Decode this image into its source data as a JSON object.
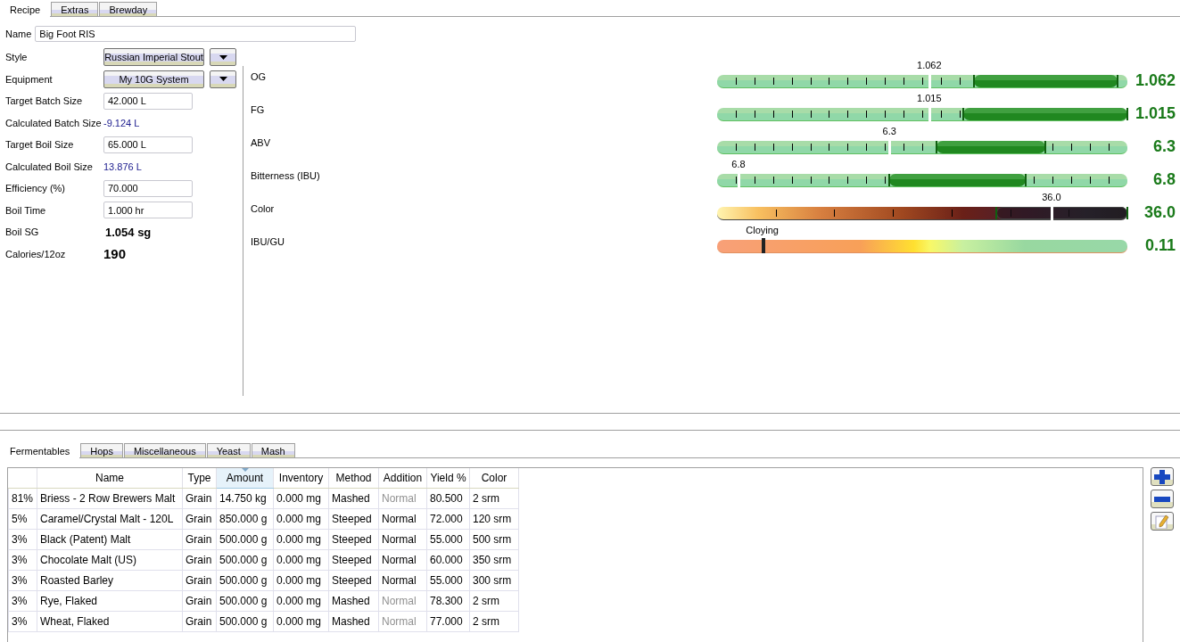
{
  "top_tabs": [
    {
      "label": "Recipe",
      "selected": true
    },
    {
      "label": "Extras",
      "selected": false
    },
    {
      "label": "Brewday",
      "selected": false
    }
  ],
  "name": {
    "label": "Name",
    "value": "Big Foot RIS"
  },
  "fields": [
    {
      "kind": "select",
      "label": "Style",
      "value": "Russian Imperial Stout"
    },
    {
      "kind": "select",
      "label": "Equipment",
      "value": "My 10G System"
    },
    {
      "kind": "input",
      "label": "Target Batch Size",
      "value": "42.000 L"
    },
    {
      "kind": "calc",
      "label": "Calculated Batch Size",
      "value": "-9.124 L"
    },
    {
      "kind": "input",
      "label": "Target Boil Size",
      "value": "65.000 L"
    },
    {
      "kind": "calc",
      "label": "Calculated Boil Size",
      "value": "13.876 L"
    },
    {
      "kind": "input",
      "label": "Efficiency (%)",
      "value": "70.000"
    },
    {
      "kind": "input",
      "label": "Boil Time",
      "value": "1.000 hr"
    },
    {
      "kind": "bold",
      "label": "Boil SG",
      "value": "1.054 sg"
    },
    {
      "kind": "big",
      "label": "Calories/12oz",
      "value": "190"
    }
  ],
  "gauges": [
    {
      "kind": "range",
      "label": "OG",
      "marker_label": "1.062",
      "level": 0.517,
      "range_start": {
        "level": 0.626
      },
      "range_end": {
        "level": 0.976
      },
      "value": "1.062"
    },
    {
      "kind": "range",
      "label": "FG",
      "marker_label": "1.015",
      "level": 0.517,
      "range_start": {
        "level": 0.6
      },
      "range_end": {
        "level": 1.0
      },
      "value": "1.015"
    },
    {
      "kind": "range",
      "label": "ABV",
      "marker_label": "6.3",
      "level": 0.42,
      "range_start": {
        "level": 0.535
      },
      "range_end": {
        "level": 0.8
      },
      "value": "6.3"
    },
    {
      "kind": "range",
      "label": "Bitterness (IBU)",
      "marker_label": "6.8",
      "level": 0.052,
      "range_start": {
        "level": 0.42
      },
      "range_end": {
        "level": 0.752
      },
      "value": "6.8"
    },
    {
      "kind": "color",
      "label": "Color",
      "marker_label": "36.0",
      "level": 0.815,
      "range_start": {
        "level": 0.68
      },
      "range_end": {
        "level": 1.0
      },
      "value": "36.0"
    },
    {
      "kind": "balance",
      "label": "IBU/GU",
      "marker_label": "Cloying",
      "level": 0.11,
      "value": "0.11"
    }
  ],
  "bottom_tabs": [
    {
      "label": "Fermentables",
      "selected": true
    },
    {
      "label": "Hops",
      "selected": false
    },
    {
      "label": "Miscellaneous",
      "selected": false
    },
    {
      "label": "Yeast",
      "selected": false
    },
    {
      "label": "Mash",
      "selected": false
    }
  ],
  "table": {
    "columns": [
      {
        "sorted": false
      },
      {
        "label": "Name",
        "sorted": false
      },
      {
        "label": "Type",
        "sorted": false
      },
      {
        "label": "Amount",
        "sorted": true
      },
      {
        "label": "Inventory",
        "sorted": false
      },
      {
        "label": "Method",
        "sorted": false
      },
      {
        "label": "Addition",
        "sorted": false
      },
      {
        "label": "Yield %",
        "sorted": false
      },
      {
        "label": "Color",
        "sorted": false
      }
    ],
    "rows": [
      {
        "cells": [
          "81%",
          "Briess - 2 Row Brewers Malt",
          "Grain",
          "14.750 kg",
          "0.000 mg",
          "Mashed",
          "Normal",
          "80.500",
          "2 srm"
        ],
        "addition_disabled": true
      },
      {
        "cells": [
          "5%",
          "Caramel/Crystal Malt - 120L",
          "Grain",
          "850.000 g",
          "0.000 mg",
          "Steeped",
          "Normal",
          "72.000",
          "120 srm"
        ],
        "addition_disabled": false
      },
      {
        "cells": [
          "3%",
          "Black (Patent) Malt",
          "Grain",
          "500.000 g",
          "0.000 mg",
          "Steeped",
          "Normal",
          "55.000",
          "500 srm"
        ],
        "addition_disabled": false
      },
      {
        "cells": [
          "3%",
          "Chocolate Malt (US)",
          "Grain",
          "500.000 g",
          "0.000 mg",
          "Steeped",
          "Normal",
          "60.000",
          "350 srm"
        ],
        "addition_disabled": false
      },
      {
        "cells": [
          "3%",
          "Roasted Barley",
          "Grain",
          "500.000 g",
          "0.000 mg",
          "Steeped",
          "Normal",
          "55.000",
          "300 srm"
        ],
        "addition_disabled": false
      },
      {
        "cells": [
          "3%",
          "Rye, Flaked",
          "Grain",
          "500.000 g",
          "0.000 mg",
          "Mashed",
          "Normal",
          "78.300",
          "2 srm"
        ],
        "addition_disabled": true
      },
      {
        "cells": [
          "3%",
          "Wheat, Flaked",
          "Grain",
          "500.000 g",
          "0.000 mg",
          "Mashed",
          "Normal",
          "77.000",
          "2 srm"
        ],
        "addition_disabled": true
      }
    ]
  }
}
